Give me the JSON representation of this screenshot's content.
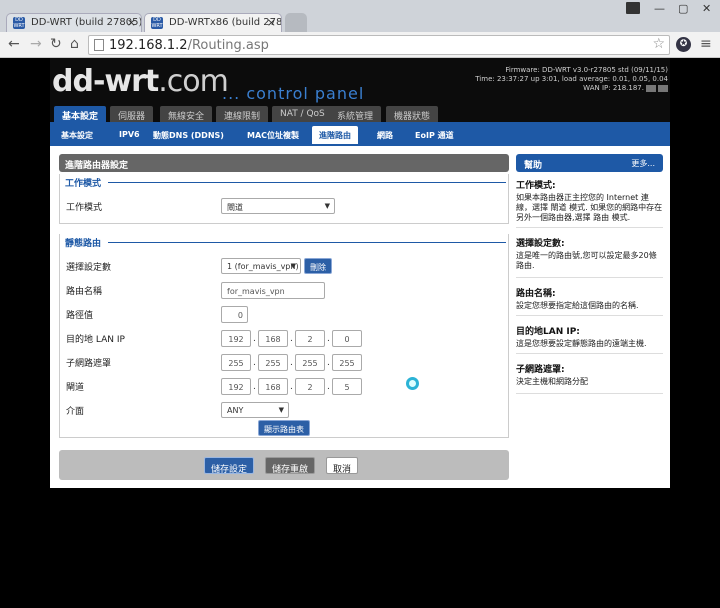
{
  "browser": {
    "tabs": [
      {
        "title": "DD-WRT (build 27805) - "
      },
      {
        "title": "DD-WRTx86 (build 2780"
      }
    ],
    "url_host": "192.168.1.2",
    "url_path": "/Routing.asp"
  },
  "header": {
    "logo": "dd-wrt",
    "logo_suffix": ".com",
    "tagline": "... control panel",
    "firmware": "Firmware: DD-WRT v3.0-r27805 std (09/11/15)",
    "time": "Time: 23:37:27 up 3:01, load average: 0.01, 0.05, 0.04",
    "wan_ip": "WAN IP: 218.187."
  },
  "nav_main": [
    "基本設定",
    "伺服器",
    "無線安全",
    "連線限制",
    "NAT / QoS",
    "系統管理",
    "機器狀態"
  ],
  "nav_sub": [
    "基本設定",
    "IPV6",
    "動態DNS (DDNS)",
    "MAC位址複製",
    "進階路由",
    "網路",
    "EoIP 通道"
  ],
  "main": {
    "title": "進階路由器設定",
    "work_mode": {
      "legend": "工作模式",
      "label": "工作模式",
      "value": "閘道"
    },
    "static_route": {
      "legend": "靜態路由",
      "select_label": "選擇設定數",
      "select_value": "1 (for_mavis_vpn)",
      "delete_label": "刪除",
      "name_label": "路由名稱",
      "name_value": "for_mavis_vpn",
      "metric_label": "路徑值",
      "metric_value": "0",
      "dest_label": "目的地 LAN IP",
      "dest": [
        "192",
        "168",
        "2",
        "0"
      ],
      "mask_label": "子網路遮罩",
      "mask": [
        "255",
        "255",
        "255",
        "255"
      ],
      "gw_label": "閘道",
      "gw": [
        "192",
        "168",
        "2",
        "5"
      ],
      "iface_label": "介面",
      "iface_value": "ANY",
      "show_table": "顯示路由表"
    }
  },
  "footer": {
    "save": "儲存設定",
    "apply": "儲存重啟",
    "cancel": "取消"
  },
  "help": {
    "title": "幫助",
    "more": "更多...",
    "items": [
      {
        "h": "工作模式:",
        "t": "如果本路由器正主控您的 Internet 連線，選擇 閘道 模式. 如果您的網路中存在另外一個路由器,選擇 路由 模式."
      },
      {
        "h": "選擇設定數:",
        "t": "這是唯一的路由號,您可以設定最多20條路由."
      },
      {
        "h": "路由名稱:",
        "t": "設定您想要指定給這個路由的名稱."
      },
      {
        "h": "目的地LAN IP:",
        "t": "這是您想要設定靜態路由的遠端主機."
      },
      {
        "h": "子網路遮罩:",
        "t": "決定主機和網路分配"
      }
    ]
  }
}
